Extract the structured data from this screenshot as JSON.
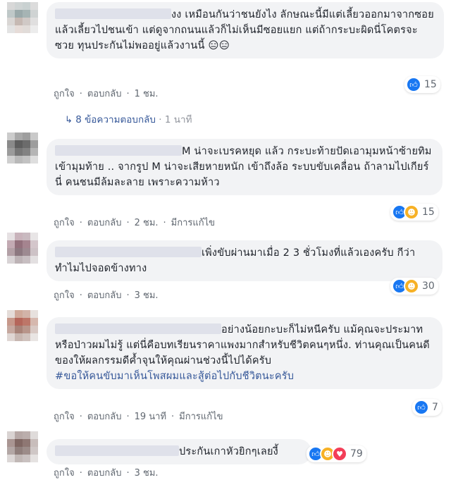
{
  "colors": {
    "like": "#1877f2",
    "haha": "#f7b125",
    "love": "#f33e58",
    "link": "#365899"
  },
  "comments": [
    {
      "text": "งง เหมือนกันว่าชนยังไง ลักษณะนี้มีแต่เลี้ยวออกมาจากซอยแล้วเลี้ยวไปชนเข้า แต่ดูจากถนนแล้วก็ไม่เห็นมีซอยแยก แต่ถ้ากระบะผิดนี่โคตรจะซวย ทุนประกันไม่พออยู่แล้วงานนี้ 😑😑",
      "reactions": {
        "icons": [
          "like"
        ],
        "count": "15"
      },
      "actions": {
        "like": "ถูกใจ",
        "reply": "ตอบกลับ",
        "time": "1 ชม.",
        "edited": ""
      }
    },
    {
      "text": "M น่าจะเบรคหยุด แล้ว กระบะท้ายปัดเอามุมหน้าซ้ายทิมเข้ามุมท้าย .. จากรูป M น่าจะเสียหายหนัก เข้าถึงล้อ ระบบขับเคลื่อน ถ้าลามไปเกียร์นี่ คนชนมีล้มละลาย เพราะความห้าว",
      "reactions": {
        "icons": [
          "like",
          "haha"
        ],
        "count": "15"
      },
      "actions": {
        "like": "ถูกใจ",
        "reply": "ตอบกลับ",
        "time": "2 ชม.",
        "edited": "มีการแก้ไข"
      }
    },
    {
      "text": "เพิ่งขับผ่านมาเมื่อ 2 3 ชั่วโมงที่แล้วเองครับ กีว่าทำไมไปจอดข้างทาง",
      "reactions": {
        "icons": [
          "like",
          "haha"
        ],
        "count": "30"
      },
      "actions": {
        "like": "ถูกใจ",
        "reply": "ตอบกลับ",
        "time": "3 ชม.",
        "edited": ""
      }
    },
    {
      "text": "อย่างน้อยกะบะก็ไม่หนีครับ แม้คุณจะประมาทหรือป่าวผมไม่รู้ แต่นี่คือบทเรียนราคาแพงมากสำหรับชีวิตคนๆหนึ่ง. ท่านคุณเป็นคนดีของให้ผลกรรมดีค้ำจุนให้คุณผ่านช่วงนี้ไปได้ครับ",
      "hashtag": "#ขอให้คนขับมาเห็นโพสผมและสู้ต่อไปกับชีวิตนะครับ",
      "reactions": {
        "icons": [
          "like"
        ],
        "count": "7"
      },
      "actions": {
        "like": "ถูกใจ",
        "reply": "ตอบกลับ",
        "time": "19 นาที",
        "edited": "มีการแก้ไข"
      }
    },
    {
      "text": "ประกันเกาหัวยิกๆเลยงี้",
      "reactions": {
        "icons": [
          "like",
          "haha",
          "love"
        ],
        "count": "79"
      },
      "actions": {
        "like": "ถูกใจ",
        "reply": "ตอบกลับ",
        "time": "3 ชม.",
        "edited": ""
      }
    }
  ],
  "replies": {
    "label": "8 ข้อความตอบกลับ",
    "time": "1 นาที"
  }
}
